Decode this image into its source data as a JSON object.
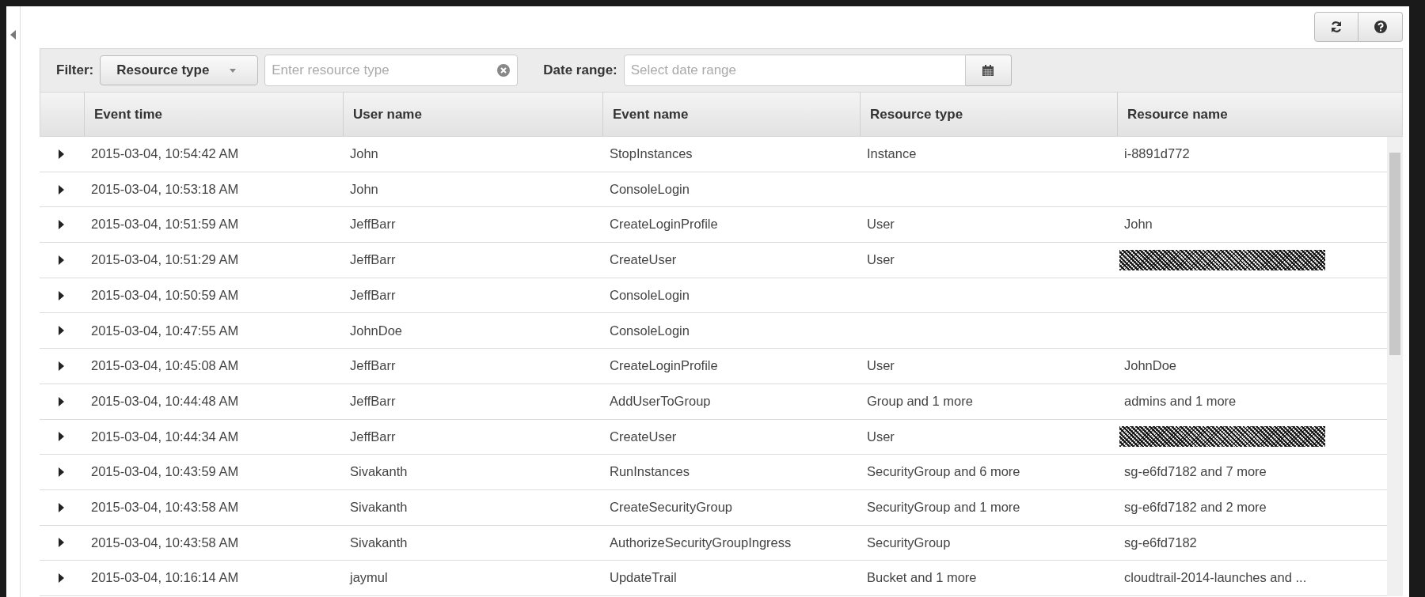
{
  "filter": {
    "label": "Filter:",
    "dropdown": "Resource type",
    "input_placeholder": "Enter resource type",
    "date_label": "Date range:",
    "date_placeholder": "Select date range"
  },
  "table": {
    "columns": [
      "Event time",
      "User name",
      "Event name",
      "Resource type",
      "Resource name"
    ],
    "rows": [
      {
        "cells": [
          "2015-03-04, 10:54:42 AM",
          "John",
          "StopInstances",
          "Instance",
          "i-8891d772"
        ],
        "redacted": false
      },
      {
        "cells": [
          "2015-03-04, 10:53:18 AM",
          "John",
          "ConsoleLogin",
          "",
          ""
        ],
        "redacted": false
      },
      {
        "cells": [
          "2015-03-04, 10:51:59 AM",
          "JeffBarr",
          "CreateLoginProfile",
          "User",
          "John"
        ],
        "redacted": false
      },
      {
        "cells": [
          "2015-03-04, 10:51:29 AM",
          "JeffBarr",
          "CreateUser",
          "User",
          ""
        ],
        "redacted": true
      },
      {
        "cells": [
          "2015-03-04, 10:50:59 AM",
          "JeffBarr",
          "ConsoleLogin",
          "",
          ""
        ],
        "redacted": false
      },
      {
        "cells": [
          "2015-03-04, 10:47:55 AM",
          "JohnDoe",
          "ConsoleLogin",
          "",
          ""
        ],
        "redacted": false
      },
      {
        "cells": [
          "2015-03-04, 10:45:08 AM",
          "JeffBarr",
          "CreateLoginProfile",
          "User",
          "JohnDoe"
        ],
        "redacted": false
      },
      {
        "cells": [
          "2015-03-04, 10:44:48 AM",
          "JeffBarr",
          "AddUserToGroup",
          "Group and 1 more",
          "admins and 1 more"
        ],
        "redacted": false
      },
      {
        "cells": [
          "2015-03-04, 10:44:34 AM",
          "JeffBarr",
          "CreateUser",
          "User",
          ""
        ],
        "redacted": true
      },
      {
        "cells": [
          "2015-03-04, 10:43:59 AM",
          "Sivakanth",
          "RunInstances",
          "SecurityGroup and 6 more",
          "sg-e6fd7182 and 7 more"
        ],
        "redacted": false
      },
      {
        "cells": [
          "2015-03-04, 10:43:58 AM",
          "Sivakanth",
          "CreateSecurityGroup",
          "SecurityGroup and 1 more",
          "sg-e6fd7182 and 2 more"
        ],
        "redacted": false
      },
      {
        "cells": [
          "2015-03-04, 10:43:58 AM",
          "Sivakanth",
          "AuthorizeSecurityGroupIngress",
          "SecurityGroup",
          "sg-e6fd7182"
        ],
        "redacted": false
      },
      {
        "cells": [
          "2015-03-04, 10:16:14 AM",
          "jaymul",
          "UpdateTrail",
          "Bucket and 1 more",
          "cloudtrail-2014-launches and ..."
        ],
        "redacted": false
      }
    ]
  }
}
